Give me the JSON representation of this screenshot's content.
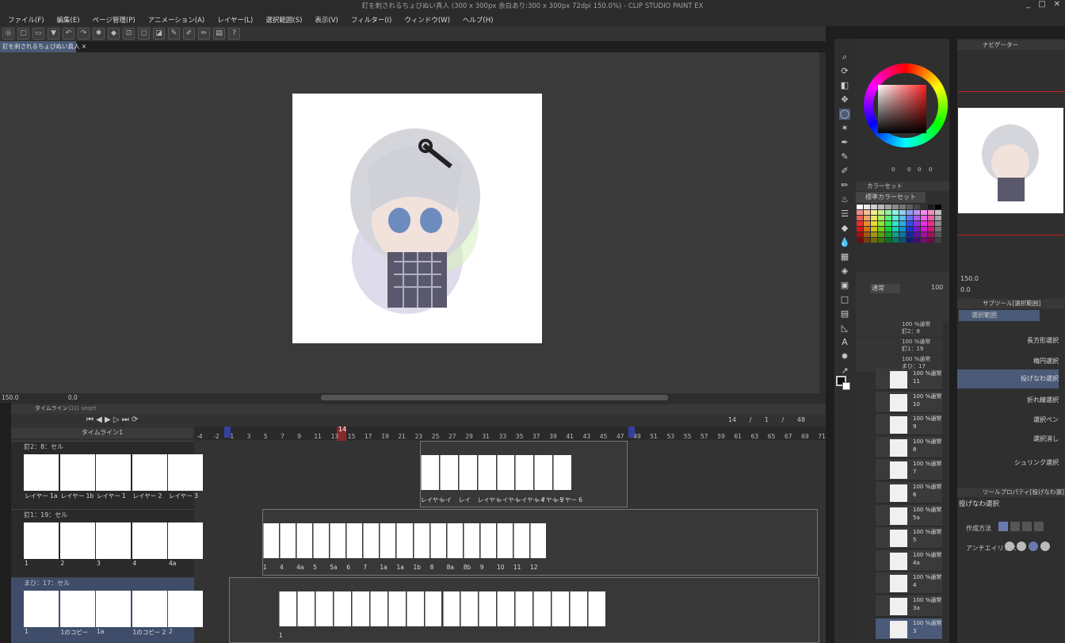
{
  "window": {
    "title": "釘を刺されるちょびぬい真人 (300 x 300px 余白あり:300 x 300px 72dpi 150.0%) - CLIP STUDIO PAINT EX",
    "controls": [
      "_",
      "□",
      "✕"
    ]
  },
  "menu": [
    "ファイル(F)",
    "編集(E)",
    "ページ管理(P)",
    "アニメーション(A)",
    "レイヤー(L)",
    "選択範囲(S)",
    "表示(V)",
    "フィルター(I)",
    "ウィンドウ(W)",
    "ヘルプ(H)"
  ],
  "doc_tab": {
    "label": "釘を刺されるちょびぬい真人",
    "close": "×"
  },
  "status": {
    "zoom": "150.0",
    "angle": "0.0"
  },
  "timeline": {
    "tabs": [
      "タイムライン",
      "ロロ seqet"
    ],
    "name": "タイムライン1",
    "current_frame": "14",
    "frame_counter": [
      "14",
      "/",
      "1",
      "/",
      "48"
    ],
    "ruler_numbers": [
      "-4",
      "-2",
      "1",
      "3",
      "5",
      "7",
      "9",
      "11",
      "13",
      "15",
      "17",
      "19",
      "21",
      "23",
      "25",
      "27",
      "29",
      "31",
      "33",
      "35",
      "37",
      "39",
      "41",
      "43",
      "45",
      "47",
      "49",
      "51",
      "53",
      "55",
      "57",
      "59",
      "61",
      "63",
      "65",
      "67",
      "69",
      "71"
    ],
    "tracks": [
      {
        "name": "釘2：8：セル",
        "cells": [
          "レイヤー 1a",
          "レイヤー 1b",
          "レイヤー 1",
          "レイヤー 2",
          "レイヤー 3"
        ],
        "tl_labels": [
          "レイヤー",
          "レイ",
          "レイ",
          "レイヤー",
          "レイヤー",
          "レイヤー 4",
          "レイヤー 5",
          "レイヤー 6"
        ]
      },
      {
        "name": "釘1：19：セル",
        "cells": [
          "1",
          "2",
          "3",
          "4",
          "4a"
        ],
        "tl_labels": [
          "1",
          "4",
          "4a",
          "5",
          "5a",
          "6",
          "7",
          "1a",
          "1a",
          "1b",
          "8",
          "8a",
          "8b",
          "9",
          "10",
          "11",
          "12"
        ]
      },
      {
        "name": "まひ：17：セル",
        "cells": [
          "1",
          "1のコピー",
          "1a",
          "1のコピー 2",
          "2"
        ],
        "tl_labels": [
          "1",
          "",
          "",
          "",
          "",
          "",
          "",
          "",
          "",
          "",
          "",
          "",
          "",
          "",
          "",
          "",
          "",
          ""
        ]
      }
    ]
  },
  "color_wheel": {
    "values": [
      "0",
      "0",
      "0",
      "0"
    ]
  },
  "colorset": {
    "title": "カラーセット",
    "selected": "標準カラーセット"
  },
  "layers": {
    "blend": "通常",
    "opacity": "100",
    "folders": [
      {
        "name": "100 %通常\n釘2：8"
      },
      {
        "name": "100 %通常\n釘1：19"
      },
      {
        "name": "100 %通常\nまひ：17"
      }
    ],
    "items": [
      {
        "pct": "100 %通常",
        "name": "11"
      },
      {
        "pct": "100 %通常",
        "name": "10"
      },
      {
        "pct": "100 %通常",
        "name": "9"
      },
      {
        "pct": "100 %通常",
        "name": "8"
      },
      {
        "pct": "100 %通常",
        "name": "7"
      },
      {
        "pct": "100 %通常",
        "name": "6"
      },
      {
        "pct": "100 %通常",
        "name": "5a"
      },
      {
        "pct": "100 %通常",
        "name": "5"
      },
      {
        "pct": "100 %通常",
        "name": "4a"
      },
      {
        "pct": "100 %通常",
        "name": "4"
      },
      {
        "pct": "100 %通常",
        "name": "3a"
      },
      {
        "pct": "100 %通常",
        "name": "3"
      }
    ]
  },
  "navigator": {
    "title": "ナビゲーター",
    "zoom": "150.0",
    "rotate": "0.0"
  },
  "subtool": {
    "title": "サブツール[選択範囲]",
    "group": "選択範囲",
    "items": [
      "長方形選択",
      "楕円選択",
      "投げなわ選択",
      "折れ線選択",
      "選択ペン",
      "選択消し",
      "シュリンク選択"
    ]
  },
  "tool_property": {
    "title": "ツールプロパティ[投げなわ選]",
    "tool": "投げなわ選択",
    "method_label": "作成方法",
    "aa_label": "アンチエイリアス"
  }
}
